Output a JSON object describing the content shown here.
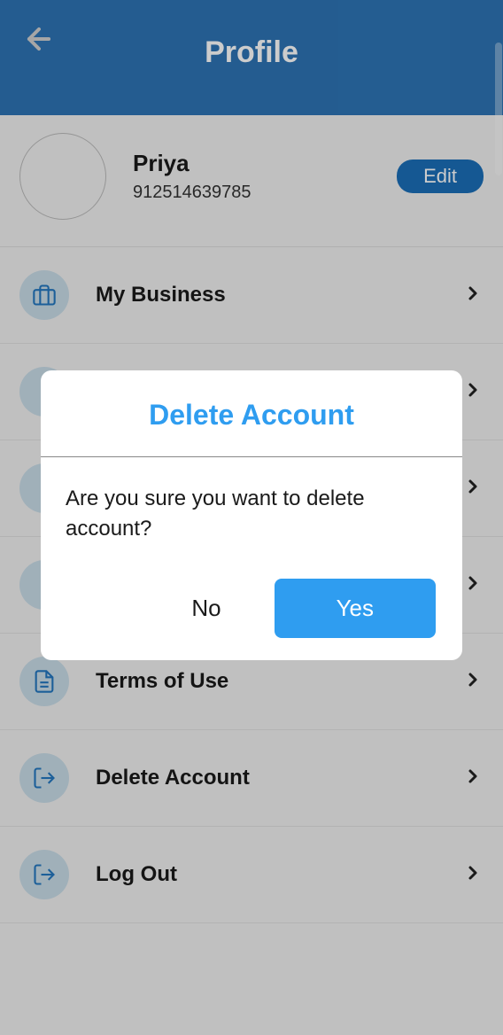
{
  "header": {
    "title": "Profile"
  },
  "profile": {
    "name": "Priya",
    "id": "912514639785",
    "edit_label": "Edit"
  },
  "menu": {
    "items": [
      {
        "label": "My Business",
        "icon": "briefcase-icon"
      },
      {
        "label": "",
        "icon": ""
      },
      {
        "label": "",
        "icon": ""
      },
      {
        "label": "",
        "icon": ""
      },
      {
        "label": "Terms of Use",
        "icon": "terms-icon"
      },
      {
        "label": "Delete Account",
        "icon": "exit-icon"
      },
      {
        "label": "Log Out",
        "icon": "exit-icon"
      }
    ]
  },
  "modal": {
    "title": "Delete Account",
    "message": "Are you sure you want to delete account?",
    "no_label": "No",
    "yes_label": "Yes"
  }
}
